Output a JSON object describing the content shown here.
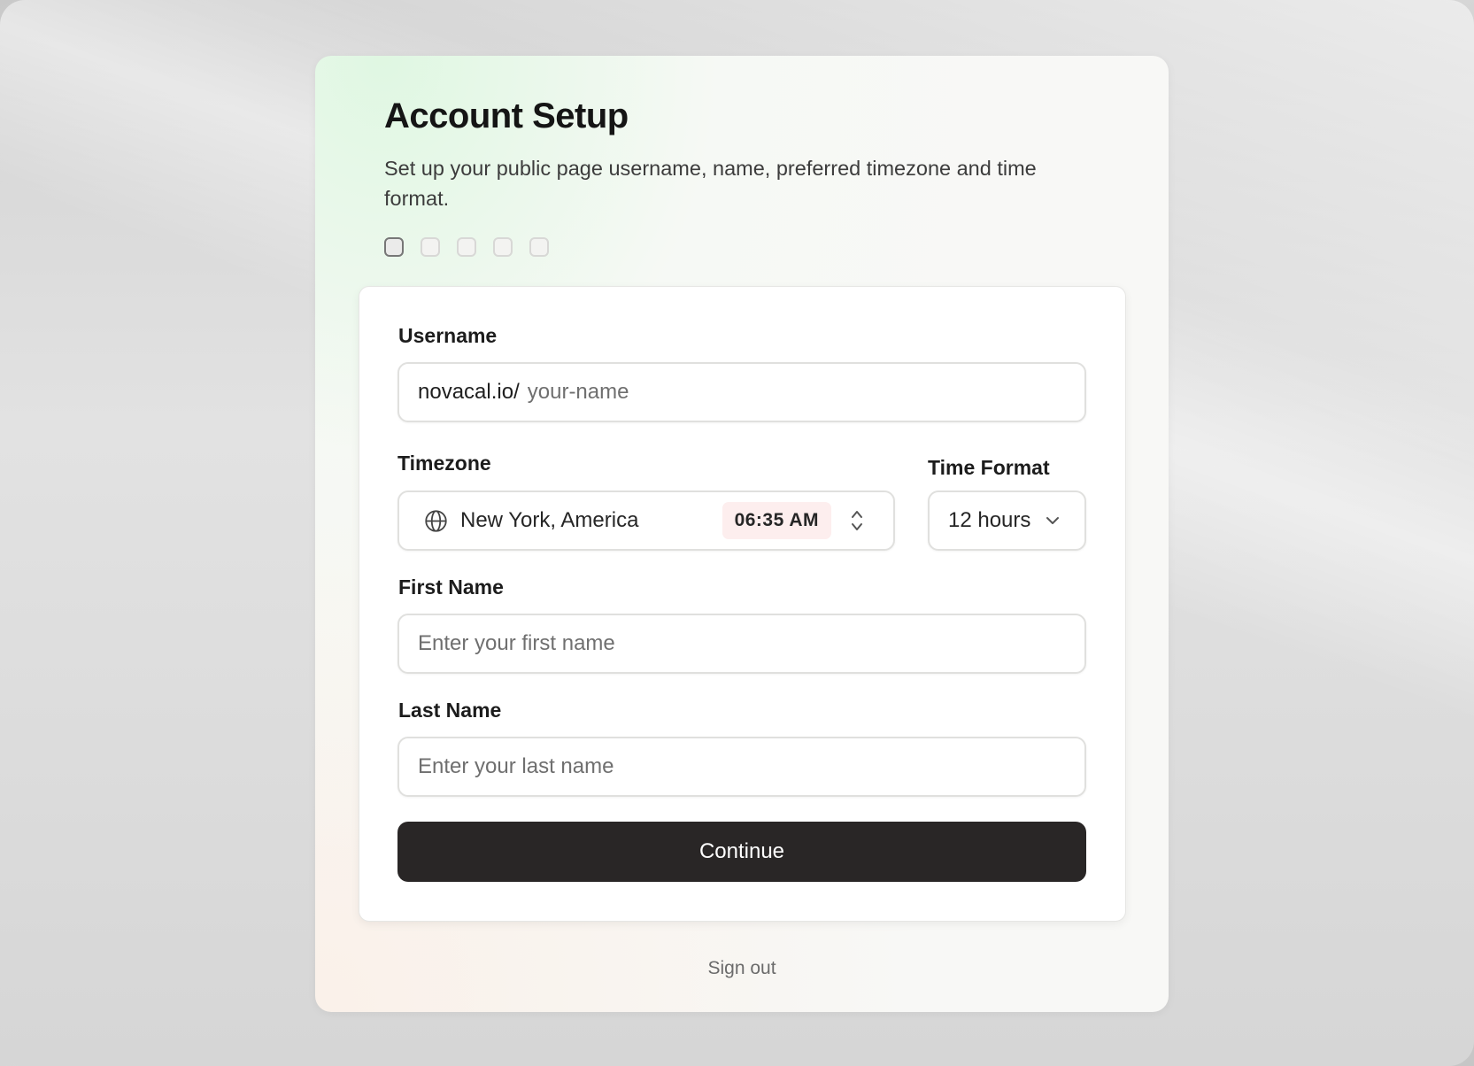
{
  "header": {
    "title": "Account Setup",
    "subtitle": "Set up your public page username, name, preferred timezone and time format."
  },
  "steps": {
    "total": 5,
    "current": 1
  },
  "form": {
    "username": {
      "label": "Username",
      "prefix": "novacal.io/",
      "placeholder": "your-name",
      "value": ""
    },
    "timezone": {
      "label": "Timezone",
      "value": "New York, America",
      "time": "06:35 AM",
      "icon": "globe-icon"
    },
    "time_format": {
      "label": "Time Format",
      "value": "12 hours",
      "icon": "chevron-down-icon"
    },
    "first_name": {
      "label": "First Name",
      "placeholder": "Enter your first name",
      "value": ""
    },
    "last_name": {
      "label": "Last Name",
      "placeholder": "Enter your last name",
      "value": ""
    },
    "continue_label": "Continue"
  },
  "footer": {
    "sign_out_label": "Sign out"
  },
  "colors": {
    "primary_button": "#292626",
    "time_badge_bg": "#fdeeee"
  }
}
